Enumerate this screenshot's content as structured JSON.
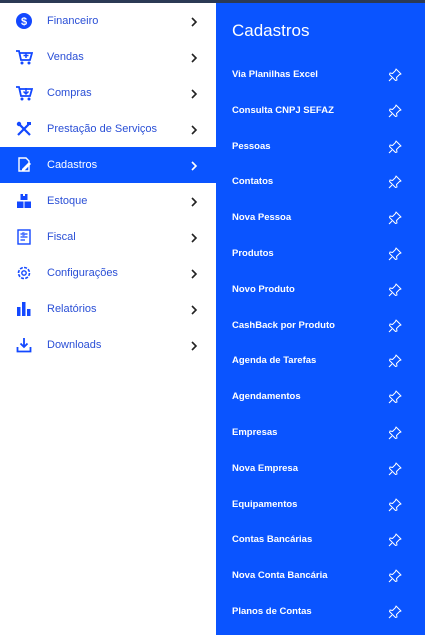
{
  "sidebar": {
    "items": [
      {
        "label": "Financeiro",
        "icon": "dollar-circle-icon"
      },
      {
        "label": "Vendas",
        "icon": "cart-plus-icon"
      },
      {
        "label": "Compras",
        "icon": "cart-download-icon"
      },
      {
        "label": "Prestação de Serviços",
        "icon": "tools-icon"
      },
      {
        "label": "Cadastros",
        "icon": "edit-document-icon"
      },
      {
        "label": "Estoque",
        "icon": "boxes-icon"
      },
      {
        "label": "Fiscal",
        "icon": "receipt-icon"
      },
      {
        "label": "Configurações",
        "icon": "gear-icon"
      },
      {
        "label": "Relatórios",
        "icon": "bar-chart-icon"
      },
      {
        "label": "Downloads",
        "icon": "download-icon"
      }
    ],
    "active_index": 4
  },
  "submenu": {
    "title": "Cadastros",
    "items": [
      "Via Planilhas Excel",
      "Consulta CNPJ SEFAZ",
      "Pessoas",
      "Contatos",
      "Nova Pessoa",
      "Produtos",
      "Novo Produto",
      "CashBack por Produto",
      "Agenda de Tarefas",
      "Agendamentos",
      "Empresas",
      "Nova Empresa",
      "Equipamentos",
      "Contas Bancárias",
      "Nova Conta Bancária",
      "Planos de Contas"
    ]
  },
  "colors": {
    "accent": "#0a54ff",
    "icon": "#1348ff",
    "label": "#2a4fd6",
    "topbar": "#2b3a55"
  }
}
